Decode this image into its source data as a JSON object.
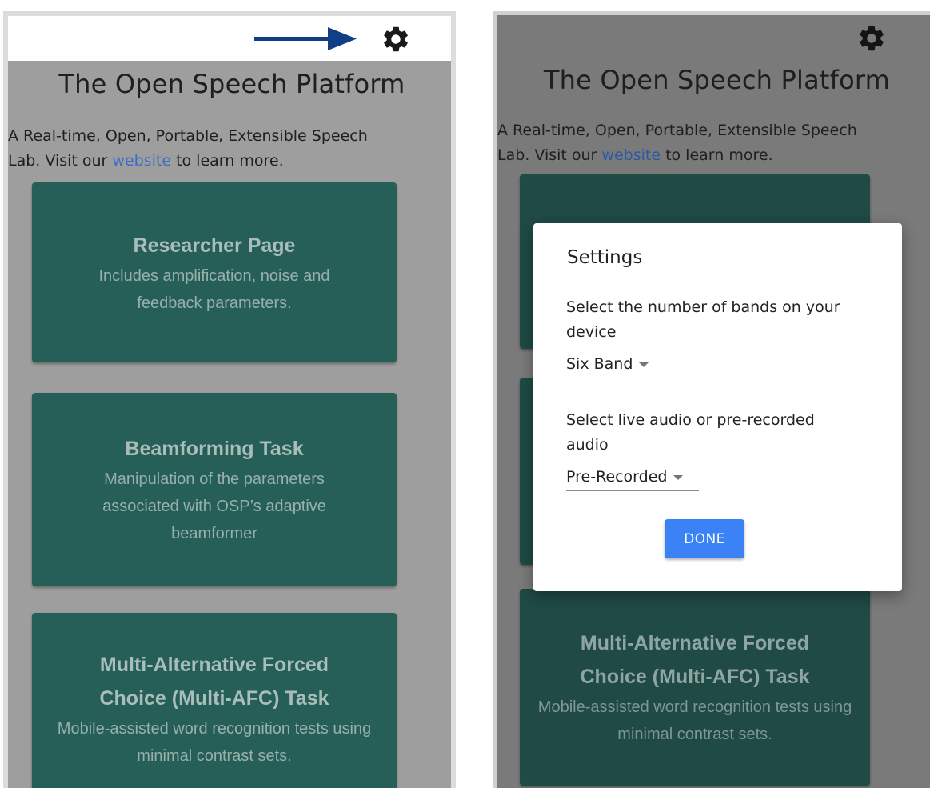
{
  "app": {
    "title": "The Open Speech Platform",
    "subtitle_before": "A Real-time, Open, Portable, Extensible Speech Lab. Visit our ",
    "subtitle_link": "website",
    "subtitle_after": " to learn more."
  },
  "cards": [
    {
      "title": "Researcher Page",
      "description": "Includes amplification, noise and feedback parameters."
    },
    {
      "title": "Beamforming Task",
      "description": "Manipulation of the parameters associated with OSP’s adaptive beamformer"
    },
    {
      "title": "Multi-Alternative Forced Choice (Multi-AFC) Task",
      "description": "Mobile-assisted word recognition tests using minimal contrast sets."
    }
  ],
  "settings_dialog": {
    "title": "Settings",
    "bands_label": "Select the number of bands on your device",
    "bands_value": "Six Band",
    "audio_label": "Select live audio or pre-recorded audio",
    "audio_value": "Pre-Recorded",
    "done_label": "DONE"
  },
  "icons": {
    "settings": "gear-icon",
    "annotation": "arrow-right-icon",
    "dropdown": "caret-down-icon"
  },
  "colors": {
    "card_bg": "#265f58",
    "link": "#3a6fc4",
    "done_button": "#3b82f6",
    "arrow": "#123e86"
  }
}
